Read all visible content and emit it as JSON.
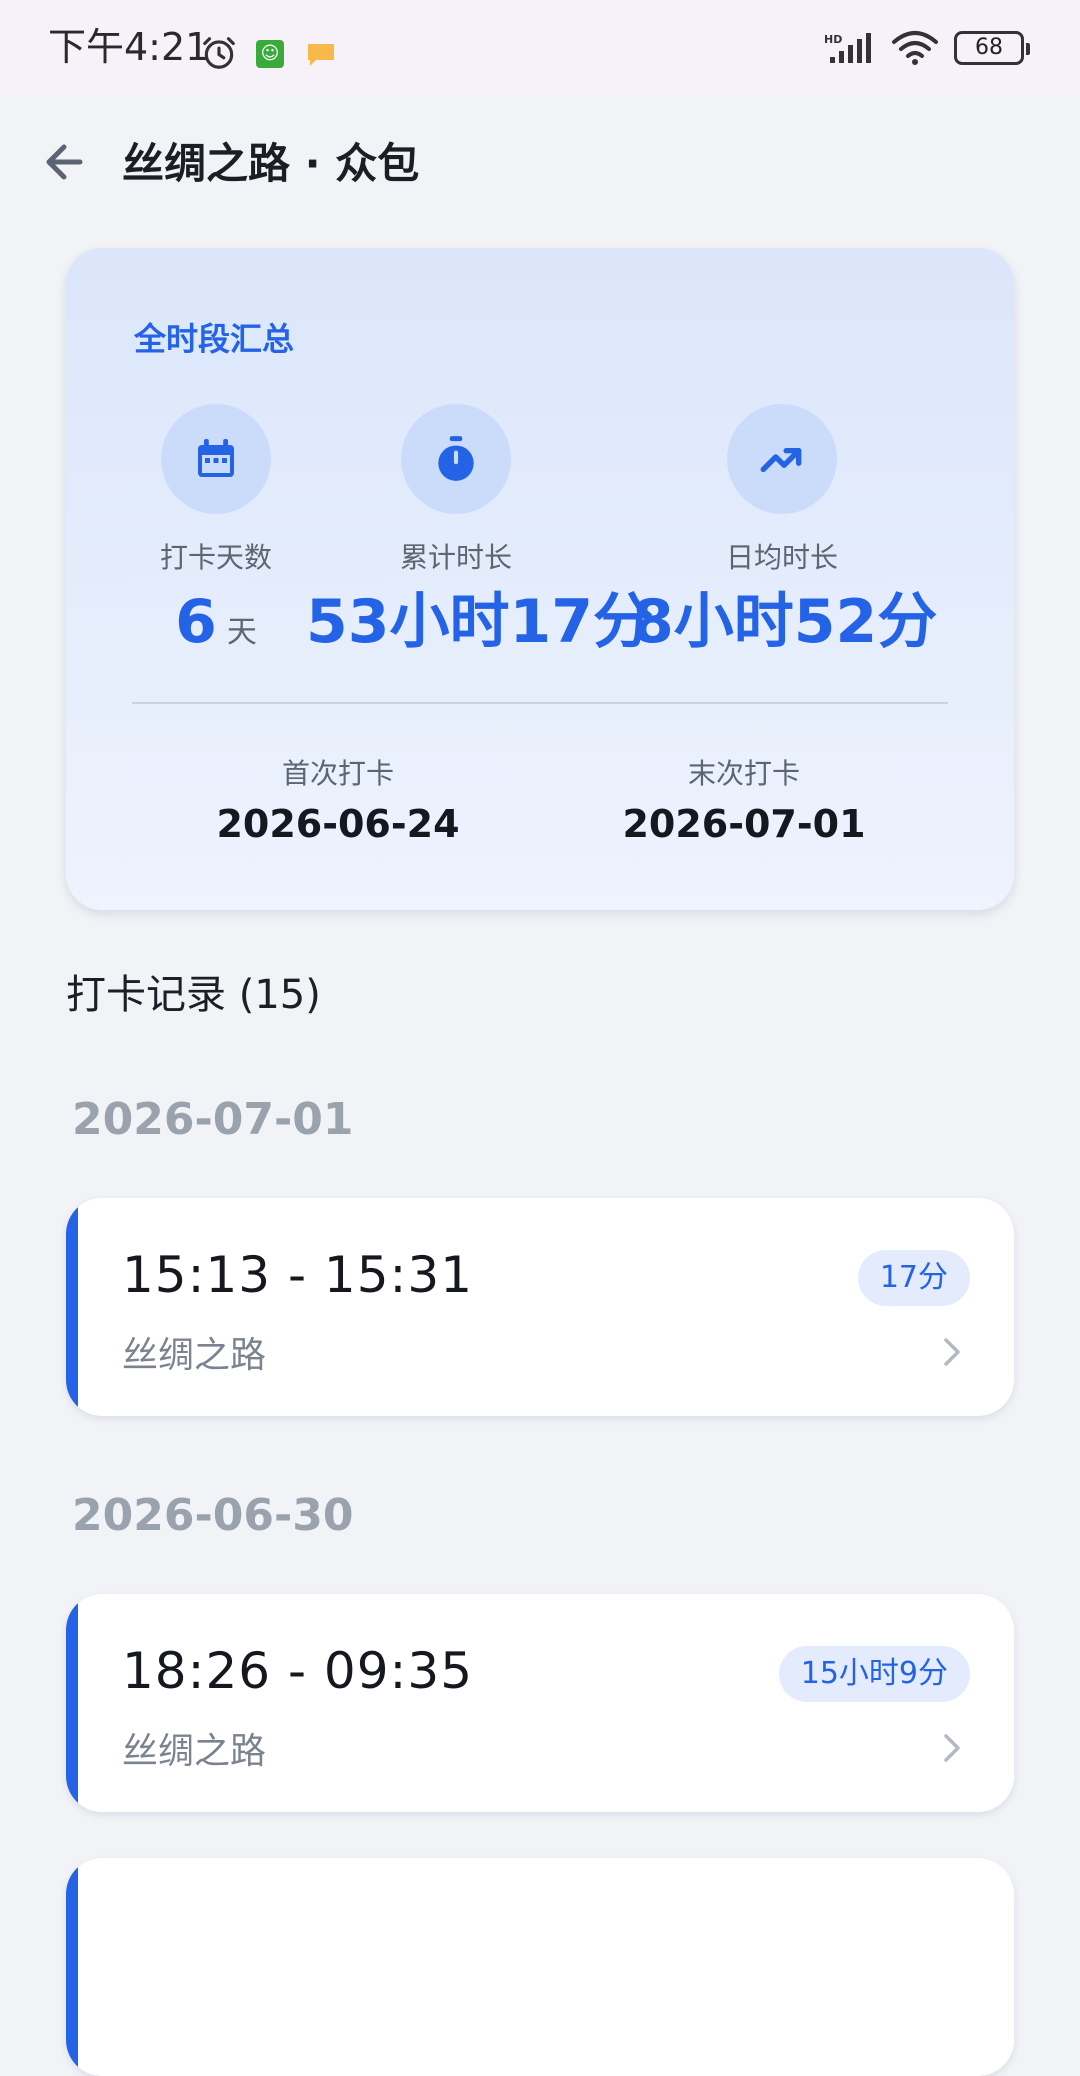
{
  "status_bar": {
    "time": "下午4:21",
    "battery": "68"
  },
  "header": {
    "title": "丝绸之路 · 众包"
  },
  "summary": {
    "title": "全时段汇总",
    "stats": [
      {
        "icon": "calendar-icon",
        "label": "打卡天数",
        "value": "6",
        "unit": "天"
      },
      {
        "icon": "timer-icon",
        "label": "累计时长",
        "value": "53小时17分",
        "unit": ""
      },
      {
        "icon": "trending-up-icon",
        "label": "日均时长",
        "value": "8小时52分",
        "unit": ""
      }
    ],
    "first_checkin_label": "首次打卡",
    "first_checkin_date": "2026-06-24",
    "last_checkin_label": "末次打卡",
    "last_checkin_date": "2026-07-01"
  },
  "records": {
    "title": "打卡记录 (15)",
    "days": [
      {
        "date": "2026-07-01",
        "entries": [
          {
            "time_range": "15:13 - 15:31",
            "place": "丝绸之路",
            "duration": "17分"
          }
        ]
      },
      {
        "date": "2026-06-30",
        "entries": [
          {
            "time_range": "18:26 - 09:35",
            "place": "丝绸之路",
            "duration": "15小时9分"
          }
        ]
      }
    ]
  },
  "colors": {
    "accent": "#2463e6",
    "background": "#f1f3f7",
    "card_gradient_top": "#dbe6fb",
    "muted_text": "#9aa2ae"
  }
}
